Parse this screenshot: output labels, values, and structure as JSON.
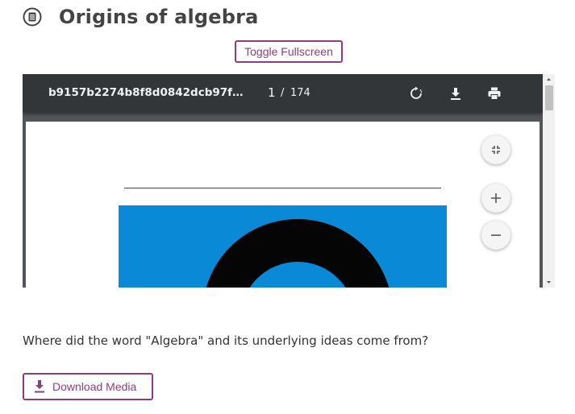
{
  "page": {
    "title": "Origins of algebra"
  },
  "actions": {
    "toggle_fullscreen": "Toggle Fullscreen",
    "download_media": "Download Media"
  },
  "viewer": {
    "filename": "b9157b2274b8f8d0842dcb97f5c79e…",
    "current_page": "1",
    "separator": "/",
    "total_pages": "174",
    "toolbar_icons": [
      "rotate-icon",
      "download-icon",
      "print-icon"
    ],
    "zoom_controls": [
      "fit-page-icon",
      "zoom-in-icon",
      "zoom-out-icon"
    ],
    "cover_color": "#0a8ad6"
  },
  "content": {
    "question": "Where did the word \"Algebra\" and its underlying ideas come from?"
  },
  "colors": {
    "accent": "#8a3f7c",
    "toolbar": "#323639",
    "viewer_bg": "#525659"
  }
}
